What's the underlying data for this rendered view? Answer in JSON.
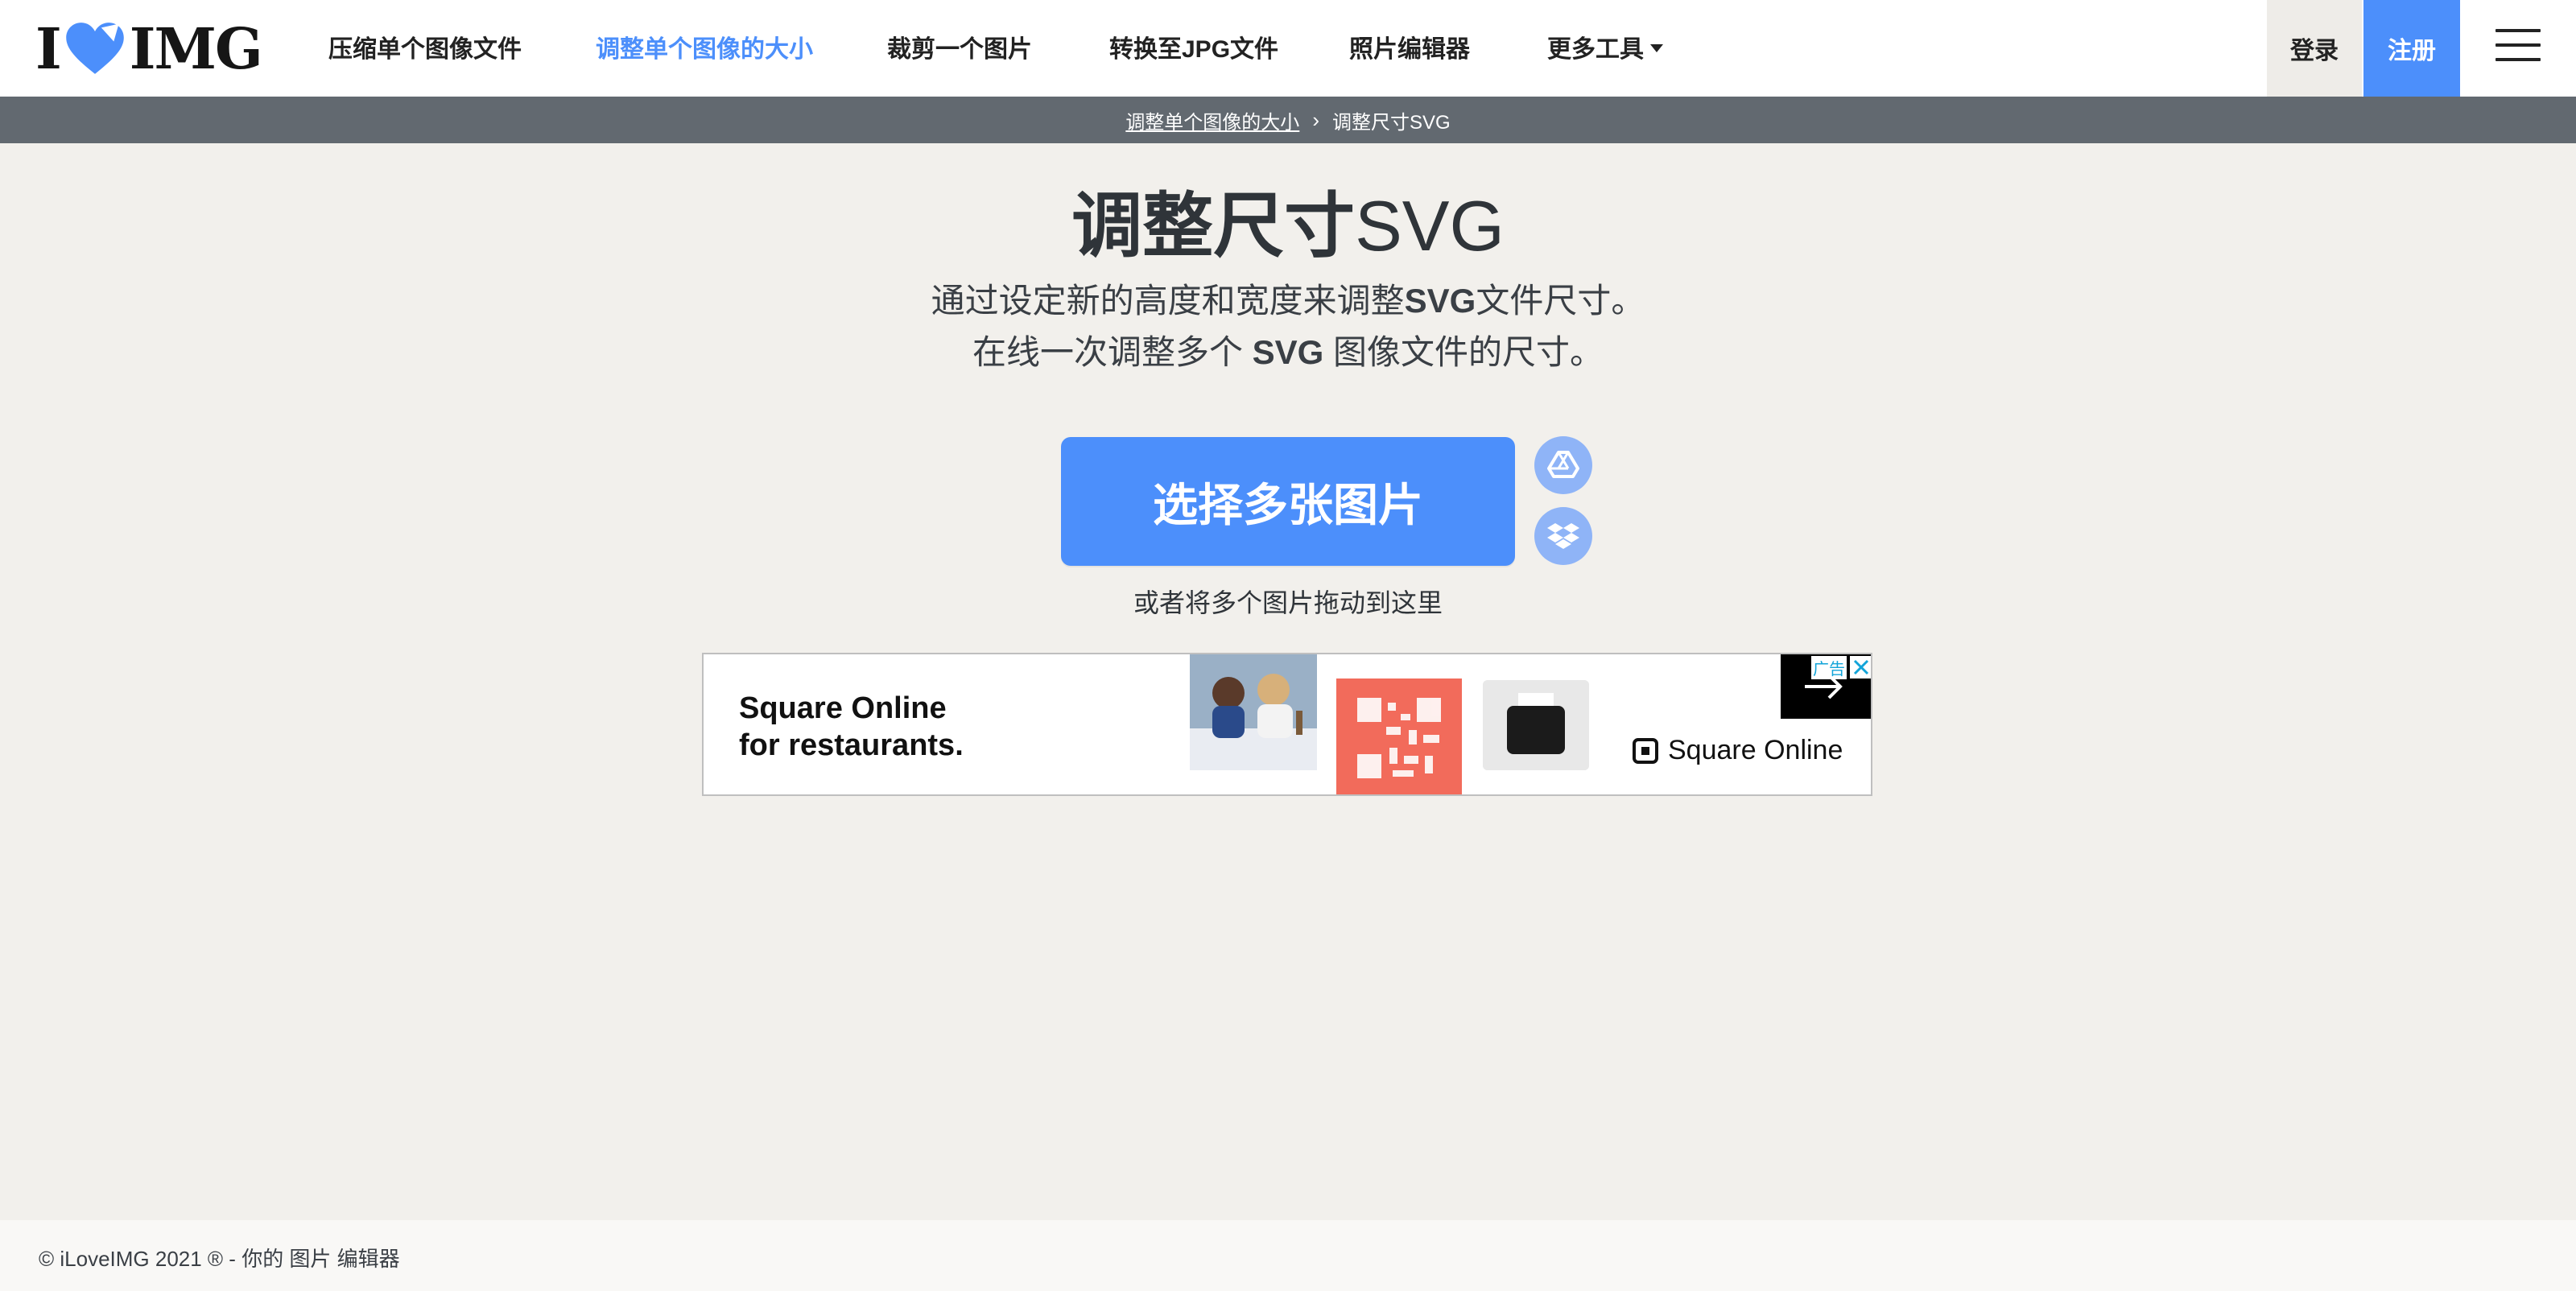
{
  "header": {
    "logo_left": "I",
    "logo_right": "IMG",
    "nav": [
      {
        "label": "压缩单个图像文件"
      },
      {
        "label": "调整单个图像的大小",
        "active": true
      },
      {
        "label": "裁剪一个图片"
      },
      {
        "label": "转换至JPG文件"
      },
      {
        "label": "照片编辑器"
      },
      {
        "label": "更多工具"
      }
    ],
    "login_label": "登录",
    "signup_label": "注册",
    "menu_icon": "hamburger-icon",
    "accent_color": "#4c8ffb"
  },
  "breadcrumb": {
    "parent": "调整单个图像的大小",
    "separator_icon": "chevron-right-icon",
    "current": "调整尺寸SVG"
  },
  "main": {
    "title_bold": "调整尺寸",
    "title_rest": "SVG",
    "subtitle_line1_a": "通过设定新的高度和宽度来调整",
    "subtitle_line1_b": "SVG",
    "subtitle_line1_c": "文件尺寸。",
    "subtitle_line2_a": "在线一次调整多个 ",
    "subtitle_line2_b": "SVG",
    "subtitle_line2_c": " 图像文件的尺寸。",
    "select_button": "选择多张图片",
    "cloud_buttons": [
      "google-drive-icon",
      "dropbox-icon"
    ],
    "drop_hint": "或者将多个图片拖动到这里"
  },
  "ad": {
    "headline_line1": "Square Online",
    "headline_line2": "for restaurants.",
    "brand": "Square Online",
    "label": "广告",
    "close_icon": "close-icon"
  },
  "footer": {
    "text": "© iLoveIMG 2021 ® - 你的 图片 编辑器"
  }
}
